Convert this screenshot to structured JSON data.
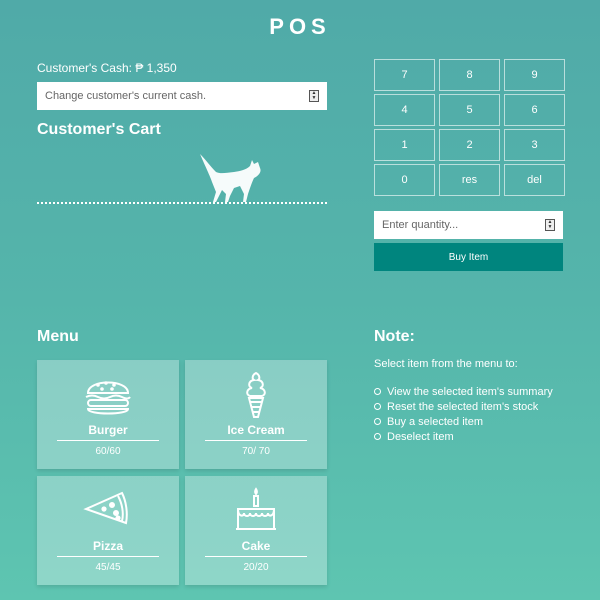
{
  "app": {
    "title": "POS"
  },
  "cash": {
    "label": "Customer's Cash: ₱ 1,350",
    "input_placeholder": "Change customer's current cash."
  },
  "cart": {
    "heading": "Customer's Cart"
  },
  "keypad": {
    "keys": [
      "7",
      "8",
      "9",
      "4",
      "5",
      "6",
      "1",
      "2",
      "3",
      "0",
      "res",
      "del"
    ]
  },
  "quantity": {
    "placeholder": "Enter quantity..."
  },
  "buy_button": {
    "label": "Buy Item"
  },
  "menu": {
    "heading": "Menu",
    "items": [
      {
        "name": "Burger",
        "stock": "60/60",
        "icon": "burger-icon"
      },
      {
        "name": "Ice Cream",
        "stock": "70/ 70",
        "icon": "ice-cream-icon"
      },
      {
        "name": "Pizza",
        "stock": "45/45",
        "icon": "pizza-icon"
      },
      {
        "name": "Cake",
        "stock": "20/20",
        "icon": "cake-icon"
      }
    ]
  },
  "note": {
    "heading": "Note:",
    "text": "Select item from the menu to:",
    "items": [
      "View the selected item's summary",
      "Reset the selected item's stock",
      "Buy a selected item",
      "Deselect item"
    ]
  },
  "colors": {
    "background_top": "#50aaa8",
    "background_bottom": "#5ec5b1",
    "button": "#00857e"
  }
}
